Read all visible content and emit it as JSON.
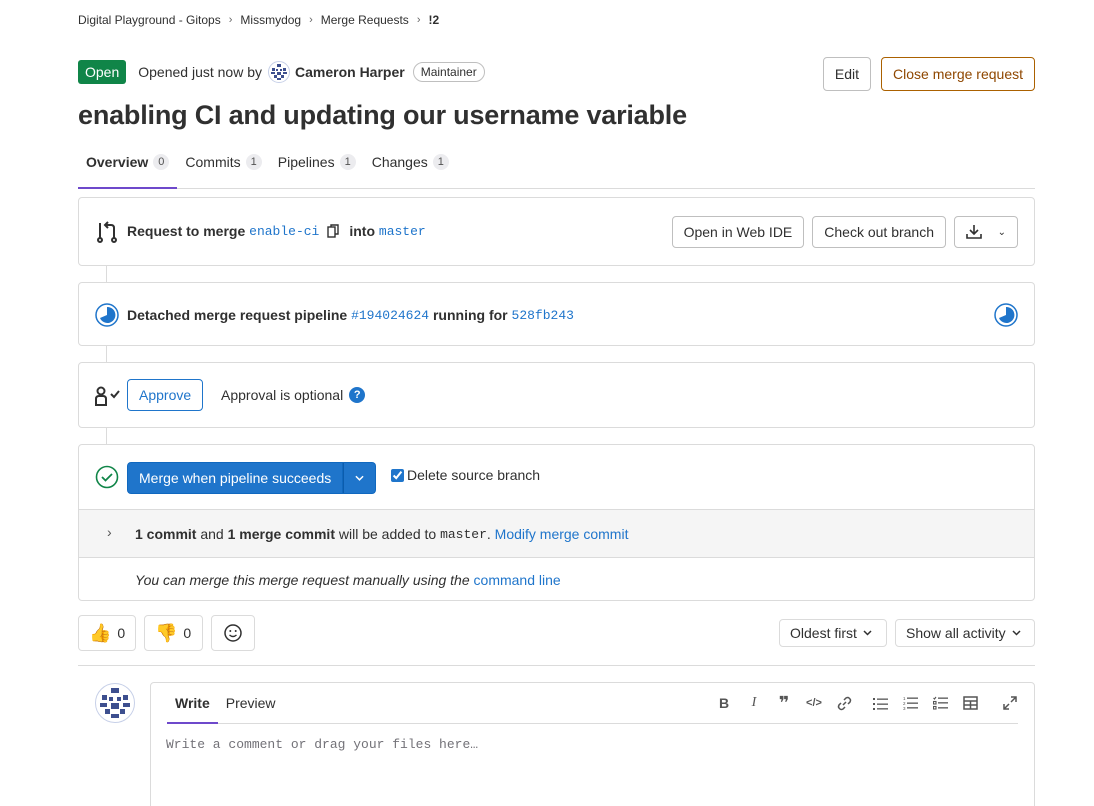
{
  "breadcrumb": [
    "Digital Playground - Gitops",
    "Missmydog",
    "Merge Requests",
    "!2"
  ],
  "header": {
    "status": "Open",
    "opened_text": "Opened just now by",
    "author": "Cameron Harper",
    "role": "Maintainer",
    "edit_label": "Edit",
    "close_label": "Close merge request"
  },
  "title": "enabling CI and updating our username variable",
  "tabs": [
    {
      "label": "Overview",
      "count": "0"
    },
    {
      "label": "Commits",
      "count": "1"
    },
    {
      "label": "Pipelines",
      "count": "1"
    },
    {
      "label": "Changes",
      "count": "1"
    }
  ],
  "merge_info": {
    "prefix": "Request to merge",
    "source": "enable-ci",
    "into": "into",
    "target": "master",
    "web_ide_label": "Open in Web IDE",
    "checkout_label": "Check out branch"
  },
  "pipeline": {
    "prefix": "Detached merge request pipeline",
    "id": "#194024624",
    "middle": "running for",
    "sha": "528fb243"
  },
  "approval": {
    "approve_label": "Approve",
    "optional_text": "Approval is optional"
  },
  "merge": {
    "button_label": "Merge when pipeline succeeds",
    "delete_branch_label": "Delete source branch",
    "commit_count": "1 commit",
    "and": "and",
    "merge_commit": "1 merge commit",
    "added_to": "will be added to",
    "branch": "master",
    "modify_link": "Modify merge commit",
    "manual_text": "You can merge this merge request manually using the",
    "command_line_link": "command line"
  },
  "reactions": {
    "thumbs_up": "0",
    "thumbs_down": "0"
  },
  "activity": {
    "sort_label": "Oldest first",
    "filter_label": "Show all activity"
  },
  "comment": {
    "write_tab": "Write",
    "preview_tab": "Preview",
    "placeholder": "Write a comment or drag your files here…"
  }
}
